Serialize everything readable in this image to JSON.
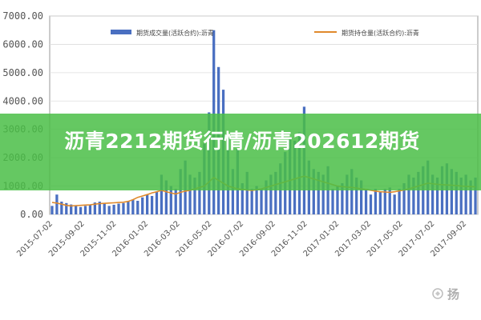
{
  "banner": {
    "title": "沥青2212期货行情/沥青202612期货",
    "background_color": "#4abe46",
    "text_color": "#ffffff"
  },
  "chart_data": {
    "type": "bar",
    "title": "",
    "xlabel": "",
    "ylabel": "",
    "grid": true,
    "legend_position": "top",
    "y_tick_labels": [
      "0.00",
      "1000.00",
      "2000.00",
      "3000.00",
      "4000.00",
      "5000.00",
      "6000.00",
      "7000.00"
    ],
    "ylim": [
      0,
      7000
    ],
    "x_tick_labels": [
      "2015-07-02",
      "2015-09-02",
      "2015-11-02",
      "2016-01-02",
      "2016-03-02",
      "2016-05-02",
      "2016-07-02",
      "2016-09-02",
      "2016-11-02",
      "2017-01-02",
      "2017-03-02",
      "2017-05-02",
      "2017-07-02",
      "2017-09-02"
    ],
    "x_count": 90,
    "series": [
      {
        "name": "期货成交量(活跃合约):沥青",
        "type": "bar",
        "color": "#4a6fc1",
        "values": [
          300,
          700,
          450,
          400,
          350,
          300,
          260,
          300,
          350,
          420,
          450,
          380,
          300,
          340,
          380,
          400,
          450,
          520,
          480,
          600,
          700,
          650,
          800,
          1400,
          1200,
          1000,
          900,
          1600,
          1900,
          1400,
          1300,
          1500,
          2500,
          3600,
          6500,
          5200,
          4400,
          2700,
          1600,
          2300,
          1100,
          1500,
          900,
          1000,
          900,
          1200,
          1400,
          1500,
          1800,
          2200,
          2700,
          2600,
          2900,
          3800,
          1900,
          1600,
          1500,
          1400,
          1700,
          900,
          1000,
          1100,
          1400,
          1600,
          1300,
          1200,
          900,
          700,
          900,
          800,
          900,
          950,
          700,
          900,
          1100,
          1400,
          1300,
          1500,
          1700,
          1900,
          1400,
          1300,
          1700,
          1800,
          1600,
          1500,
          1300,
          1400,
          1200,
          1300
        ]
      },
      {
        "name": "期货持仓量(活跃合约):沥青",
        "type": "line",
        "color": "#e08a2c",
        "values": [
          420,
          400,
          360,
          320,
          300,
          310,
          320,
          330,
          340,
          360,
          380,
          390,
          400,
          410,
          420,
          430,
          460,
          520,
          600,
          650,
          700,
          760,
          800,
          850,
          800,
          760,
          720,
          780,
          820,
          850,
          900,
          950,
          1000,
          1150,
          1300,
          1200,
          1100,
          1000,
          950,
          900,
          880,
          860,
          850,
          870,
          900,
          950,
          1000,
          1050,
          1100,
          1150,
          1200,
          1250,
          1300,
          1350,
          1300,
          1250,
          1200,
          1150,
          1100,
          1050,
          1000,
          980,
          960,
          950,
          930,
          900,
          880,
          850,
          820,
          800,
          790,
          780,
          800,
          830,
          860,
          900,
          950,
          1000,
          1050,
          1100,
          1080,
          1060,
          1050,
          1040,
          1030,
          1020,
          1000,
          990,
          980,
          970
        ]
      }
    ]
  },
  "watermark": {
    "glyph": "扬"
  }
}
